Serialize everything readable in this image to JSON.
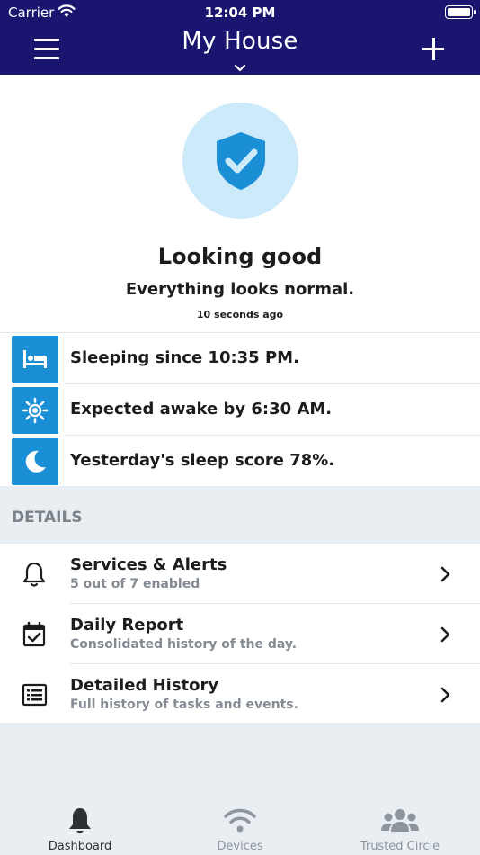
{
  "status_bar": {
    "carrier": "Carrier",
    "time": "12:04 PM"
  },
  "header": {
    "title": "My House"
  },
  "hero": {
    "title": "Looking good",
    "subtitle": "Everything looks normal.",
    "updated": "10 seconds ago",
    "icon": "shield-check-icon",
    "icon_color": "#1a8fd6",
    "circle_color": "#cceafa"
  },
  "status_items": [
    {
      "icon": "bed-icon",
      "text": "Sleeping since 10:35 PM."
    },
    {
      "icon": "sun-icon",
      "text": "Expected awake by 6:30 AM."
    },
    {
      "icon": "moon-icon",
      "text": "Yesterday's sleep score 78%."
    }
  ],
  "details": {
    "header": "DETAILS",
    "items": [
      {
        "icon": "bell-icon",
        "title": "Services & Alerts",
        "subtitle": "5 out of 7 enabled"
      },
      {
        "icon": "calendar-check-icon",
        "title": "Daily Report",
        "subtitle": "Consolidated history of the day."
      },
      {
        "icon": "list-icon",
        "title": "Detailed History",
        "subtitle": "Full history of tasks and events."
      }
    ]
  },
  "tabs": [
    {
      "icon": "bell-icon",
      "label": "Dashboard",
      "active": true
    },
    {
      "icon": "wifi-icon",
      "label": "Devices",
      "active": false
    },
    {
      "icon": "group-icon",
      "label": "Trusted Circle",
      "active": false
    }
  ],
  "colors": {
    "header_bg": "#1a1670",
    "accent": "#1a8fd6",
    "tab_active": "#2c3136",
    "tab_inactive": "#8e959c"
  }
}
